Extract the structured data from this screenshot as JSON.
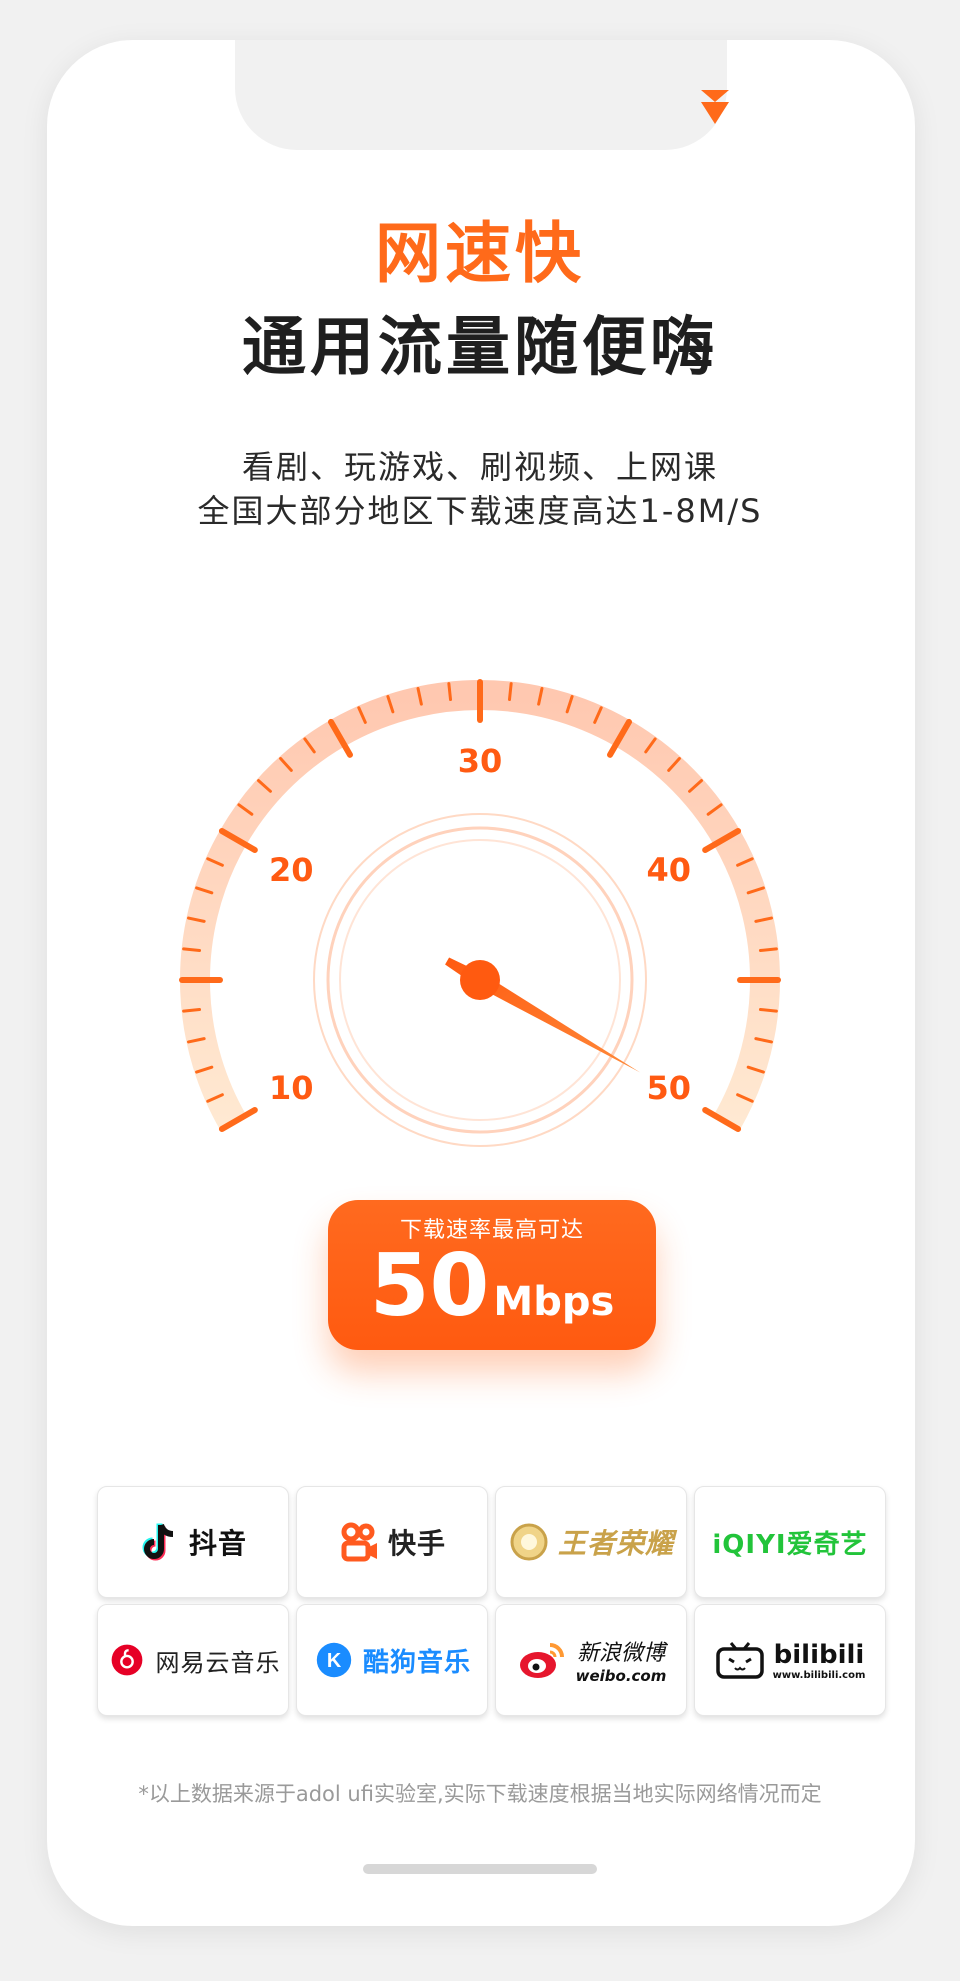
{
  "headline": {
    "accent": "网速快",
    "main": "通用流量随便嗨",
    "subtitle_line1": "看剧、玩游戏、刷视频、上网课",
    "subtitle_line2": "全国大部分地区下载速度高达1-8M/S"
  },
  "gauge": {
    "labels": [
      "10",
      "20",
      "30",
      "40",
      "50"
    ],
    "min": 10,
    "max": 50,
    "needle_value": 50,
    "accent_color": "#ff6a1a"
  },
  "speed_card": {
    "caption": "下载速率最高可达",
    "value": "50",
    "unit": "Mbps"
  },
  "apps": [
    {
      "name": "抖音",
      "icon": "douyin-icon",
      "color": "#111111"
    },
    {
      "name": "快手",
      "icon": "kuaishou-icon",
      "color": "#ff5a1f"
    },
    {
      "name": "王者荣耀",
      "icon": "honor-of-kings-icon",
      "color": "#c9a24a"
    },
    {
      "name": "iQIYI爱奇艺",
      "icon": "iqiyi-icon",
      "color": "#22c43a"
    },
    {
      "name": "网易云音乐",
      "icon": "netease-music-icon",
      "color": "#e60026"
    },
    {
      "name": "酷狗音乐",
      "icon": "kugou-icon",
      "color": "#1a8cff"
    },
    {
      "name": "新浪微博",
      "sub": "weibo.com",
      "icon": "weibo-icon",
      "color": "#e6162d"
    },
    {
      "name": "bilibili",
      "sub": "www.bilibili.com",
      "icon": "bilibili-icon",
      "color": "#111111"
    }
  ],
  "footnote": "*以上数据来源于adol ufi实验室,实际下载速度根据当地实际网络情况而定"
}
